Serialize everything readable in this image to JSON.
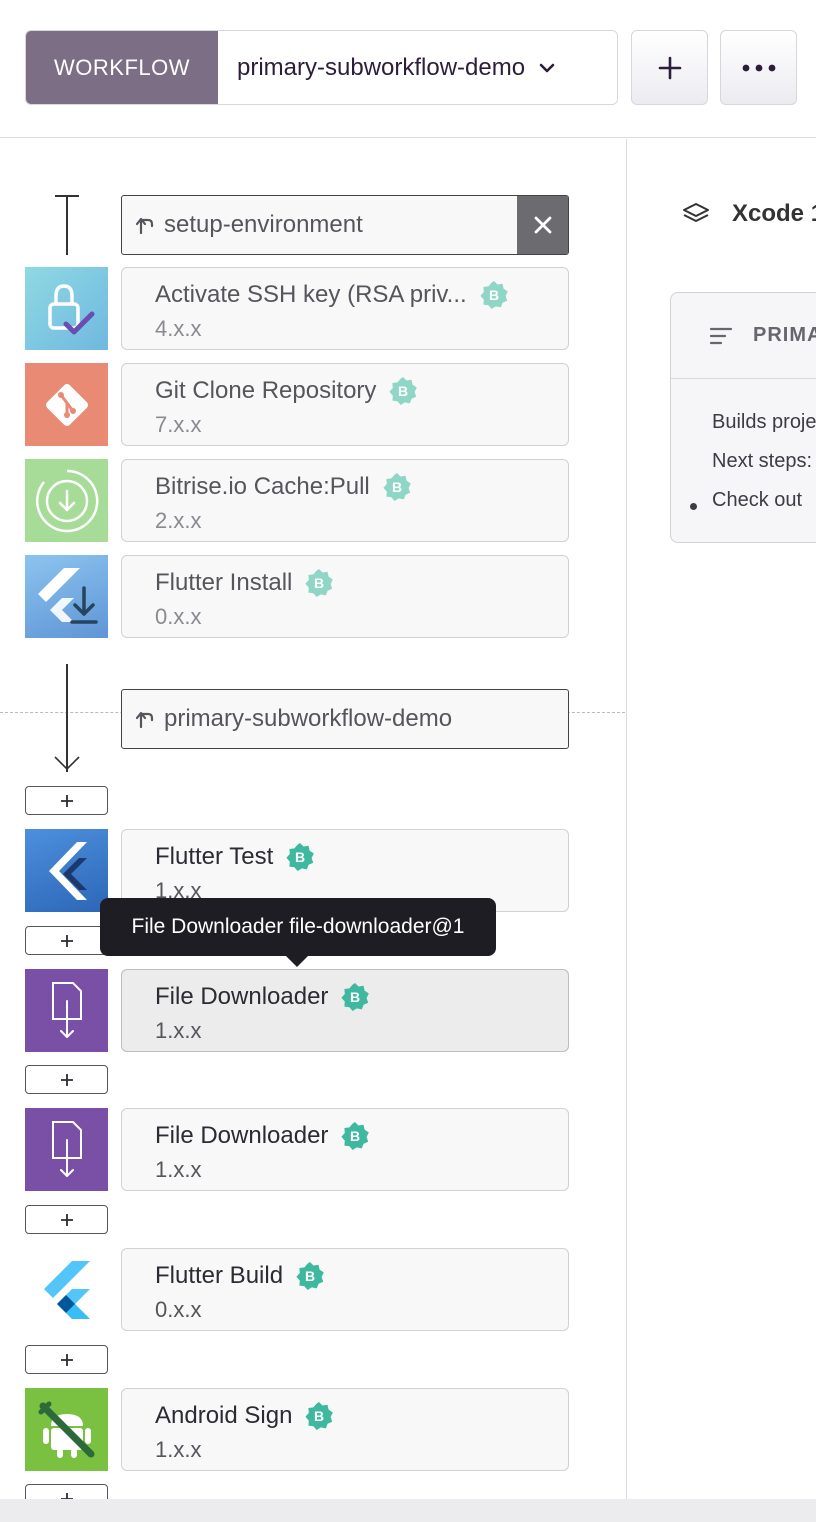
{
  "header": {
    "workflow_label": "WORKFLOW",
    "workflow_name": "primary-subworkflow-demo",
    "add_icon": "plus-icon",
    "more_icon": "more-dots-icon"
  },
  "flows": {
    "before": {
      "label": "setup-environment",
      "icon": "before-run-arrow-icon"
    },
    "main": {
      "label": "primary-subworkflow-demo",
      "icon": "before-run-arrow-icon"
    }
  },
  "before_steps": [
    {
      "title": "Activate SSH key (RSA priv...",
      "version": "4.x.x",
      "icon": "ssh-lock-icon"
    },
    {
      "title": "Git Clone Repository",
      "version": "7.x.x",
      "icon": "git-icon"
    },
    {
      "title": "Bitrise.io Cache:Pull",
      "version": "2.x.x",
      "icon": "cache-pull-icon"
    },
    {
      "title": "Flutter Install",
      "version": "0.x.x",
      "icon": "flutter-install-icon"
    }
  ],
  "steps": [
    {
      "title": "Flutter Test",
      "version": "1.x.x",
      "icon": "flutter-test-icon"
    },
    {
      "title": "File Downloader",
      "version": "1.x.x",
      "icon": "file-download-icon",
      "selected": true
    },
    {
      "title": "File Downloader",
      "version": "1.x.x",
      "icon": "file-download-icon"
    },
    {
      "title": "Flutter Build",
      "version": "0.x.x",
      "icon": "flutter-icon"
    },
    {
      "title": "Android Sign",
      "version": "1.x.x",
      "icon": "android-sign-icon"
    }
  ],
  "tooltip": "File Downloader file-downloader@1",
  "badge_label": "B",
  "add_step_label": "+",
  "right_panel": {
    "stack": "Xcode 1",
    "readme": {
      "title": "PRIMA",
      "line1": "Builds proje",
      "line2": "Next steps:",
      "bullet": "Check out"
    }
  },
  "colors": {
    "workflow_label_bg": "#7c6f85",
    "badge": "#3fb8a0",
    "tooltip_bg": "#1f1d24",
    "ssh_icon_bg": "#7fcde0",
    "git_icon_bg": "#e88a74",
    "cache_icon_bg": "#a6dc98",
    "flutter_install_bg": "#6fa7e0",
    "flutter_test_bg": "#3a78c9",
    "file_download_bg": "#7a4fa6",
    "android_sign_bg": "#7ac041"
  }
}
